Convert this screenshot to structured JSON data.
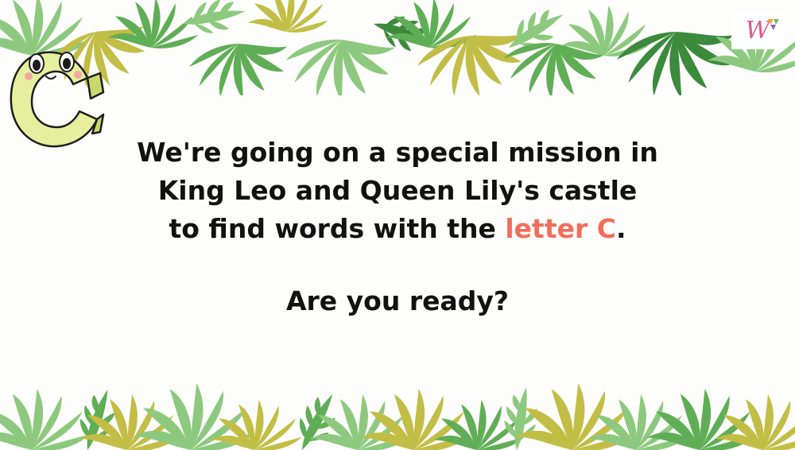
{
  "slide": {
    "line1": "We're going on a special mission in",
    "line2": "King Leo and Queen Lily's castle",
    "line3_before": "to find words with the",
    "line3_highlight": "letter C",
    "line3_after": ".",
    "question": "Are you ready?"
  },
  "mascot": {
    "letter": "C"
  },
  "logo": {
    "text": "W"
  },
  "colors": {
    "text": "#111111",
    "highlight": "#f26d5b",
    "leaf_light": "#8cc97e",
    "leaf_mid": "#5fae55",
    "leaf_dark": "#3c8a3c",
    "leaf_olive": "#c2bd45",
    "mascot_body": "#e6ef9e",
    "background": "#fdfdfb"
  },
  "icons": [
    "tropical-leaves-top",
    "tropical-leaves-bottom",
    "letter-c-mascot-icon",
    "brand-logo-icon"
  ]
}
